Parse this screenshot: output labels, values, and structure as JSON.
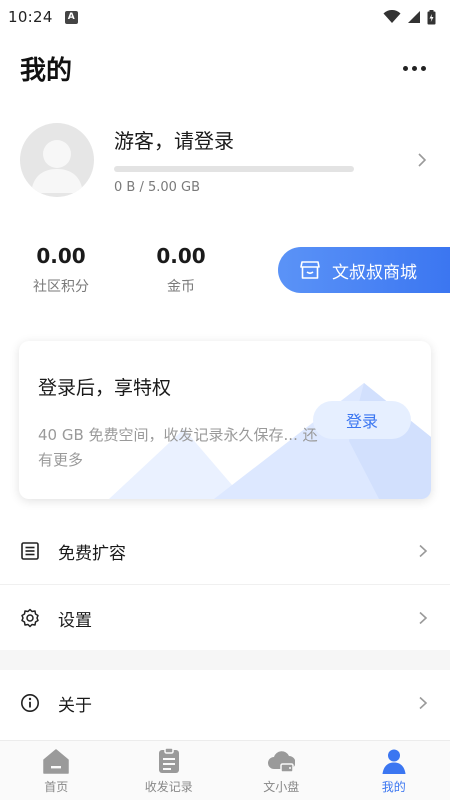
{
  "status": {
    "time": "10:24",
    "notification": "A"
  },
  "header": {
    "title": "我的"
  },
  "profile": {
    "guest_text": "游客，请登录",
    "storage_text": "0 B / 5.00 GB",
    "storage_fraction": 0
  },
  "stats": {
    "points_value": "0.00",
    "points_label": "社区积分",
    "coins_value": "0.00",
    "coins_label": "金币"
  },
  "mall": {
    "label": "文叔叔商城"
  },
  "login_card": {
    "title": "登录后，享特权",
    "description": "40 GB 免费空间，收发记录永久保存... 还有更多",
    "button": "登录"
  },
  "menu": [
    {
      "label": "免费扩容",
      "icon": "list-icon"
    },
    {
      "label": "设置",
      "icon": "gear-icon"
    },
    {
      "label": "关于",
      "icon": "info-icon"
    }
  ],
  "nav": [
    {
      "label": "首页",
      "icon": "home-icon"
    },
    {
      "label": "收发记录",
      "icon": "clipboard-icon"
    },
    {
      "label": "文小盘",
      "icon": "cloud-drive-icon"
    },
    {
      "label": "我的",
      "icon": "person-icon",
      "active": true
    }
  ],
  "colors": {
    "accent": "#3b76f1",
    "muted": "#7a7a7a",
    "inactive_nav": "#888888"
  }
}
